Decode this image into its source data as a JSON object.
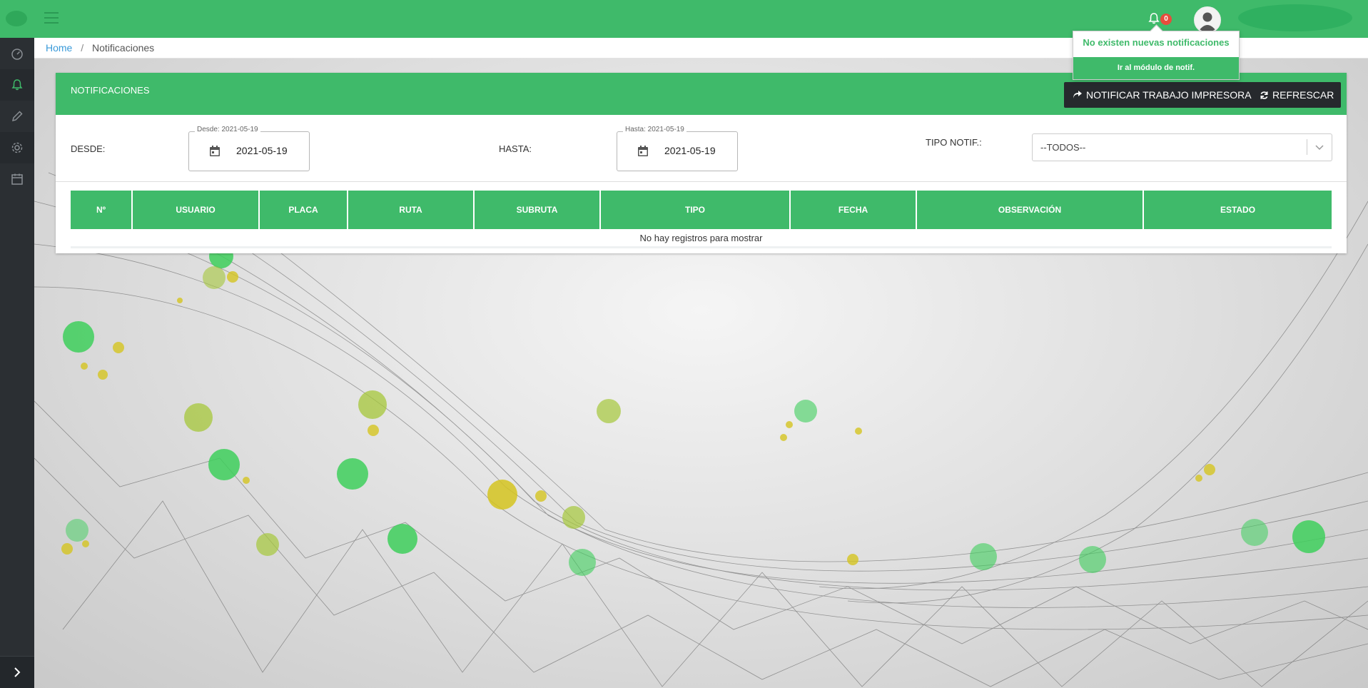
{
  "header": {
    "notifications_count": "0"
  },
  "breadcrumb": {
    "home": "Home",
    "separator": "/",
    "current": "Notificaciones"
  },
  "notifications_dropdown": {
    "empty_text": "No existen nuevas notificaciones",
    "link_text": "Ir al módulo de notif."
  },
  "card": {
    "title": "NOTIFICACIONES",
    "notify_button": "NOTIFICAR TRABAJO IMPRESORA",
    "refresh_button": "REFRESCAR"
  },
  "filters": {
    "desde_label": "DESDE:",
    "desde_legend": "Desde: 2021-05-19",
    "desde_value": "2021-05-19",
    "hasta_label": "HASTA:",
    "hasta_legend": "Hasta: 2021-05-19",
    "hasta_value": "2021-05-19",
    "tipo_label": "TIPO NOTIF.:",
    "tipo_value": "--TODOS--"
  },
  "table": {
    "columns": [
      "Nº",
      "USUARIO",
      "PLACA",
      "RUTA",
      "SUBRUTA",
      "TIPO",
      "FECHA",
      "OBSERVACIÓN",
      "ESTADO"
    ],
    "empty_text": "No hay registros para mostrar"
  },
  "icons": {
    "sidebar": [
      "speedometer-icon",
      "bell-icon",
      "pencil-icon",
      "gear-icon",
      "calendar-icon"
    ],
    "expand": "chevron-right-icon"
  },
  "colors": {
    "brand_green": "#3fba6a",
    "sidebar_dark": "#2b2f33",
    "button_dark": "#26292d",
    "badge_red": "#e74c3c",
    "link_blue": "#3a9ad9"
  }
}
